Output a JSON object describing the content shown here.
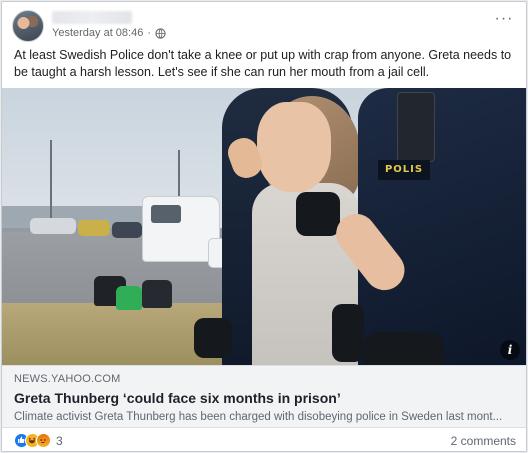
{
  "post": {
    "timestamp": "Yesterday at 08:46",
    "more_label": "···",
    "text": "At least Swedish Police don't take a knee or put up with crap from anyone.  Greta needs to be taught a harsh lesson.  Let's see if she can run her mouth from a jail cell."
  },
  "link_preview": {
    "domain": "NEWS.YAHOO.COM",
    "title": "Greta Thunberg ‘could face six months in prison’",
    "description": "Climate activist Greta Thunberg has been charged with disobeying police in Sweden last mont...",
    "info_label": "i",
    "photo_patch_text": "POLIS"
  },
  "footer": {
    "reaction_icons": [
      "like-icon",
      "haha-icon",
      "angry-icon"
    ],
    "reaction_count": "3",
    "comments": "2 comments"
  },
  "colors": {
    "like": "#1877f2",
    "haha": "#f7b125",
    "angry": "#e9710f",
    "link_bg": "#f2f3f5"
  }
}
